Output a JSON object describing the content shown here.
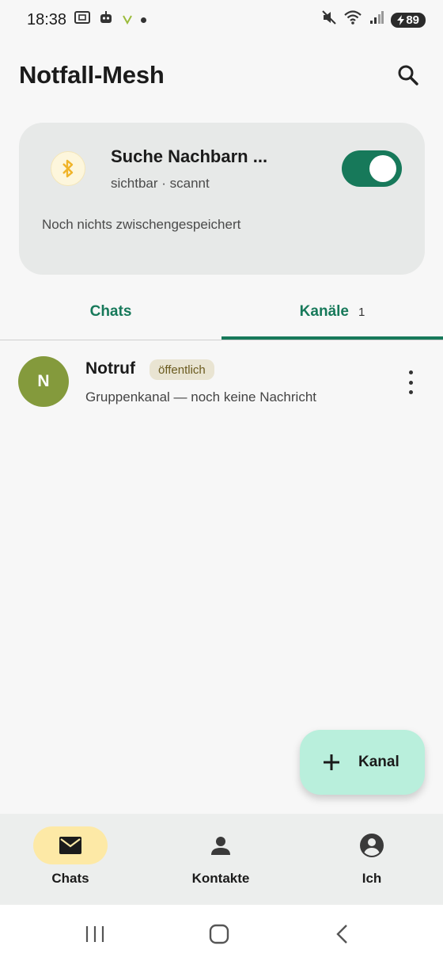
{
  "status_bar": {
    "time": "18:38",
    "battery": "89",
    "icons": [
      "screenshot-icon",
      "robot-icon",
      "vpn-v-icon",
      "dot-icon",
      "mute-icon",
      "wifi-icon",
      "signal-icon",
      "battery-icon"
    ]
  },
  "app_bar": {
    "title": "Notfall-Mesh",
    "search_icon": "search-icon"
  },
  "status_card": {
    "title": "Suche Nachbarn ...",
    "subtitle": "sichtbar · scannt",
    "note": "Noch nichts zwischengespeichert",
    "toggle_on": true,
    "icon": "bluetooth-icon"
  },
  "tabs": {
    "chats": "Chats",
    "channels": "Kanäle",
    "channels_count": "1",
    "active": "channels"
  },
  "channels": [
    {
      "avatar_letter": "N",
      "name": "Notruf",
      "badge": "öffentlich",
      "preview": "Gruppenkanal — noch keine Nachricht"
    }
  ],
  "fab": {
    "label": "Kanal",
    "icon": "plus-icon"
  },
  "bottom_nav": {
    "chats": "Chats",
    "contacts": "Kontakte",
    "me": "Ich",
    "active": "chats"
  },
  "colors": {
    "accent": "#17795a",
    "fab": "#b9efdc",
    "active_nav": "#fde9a6",
    "avatar": "#849a3c"
  }
}
